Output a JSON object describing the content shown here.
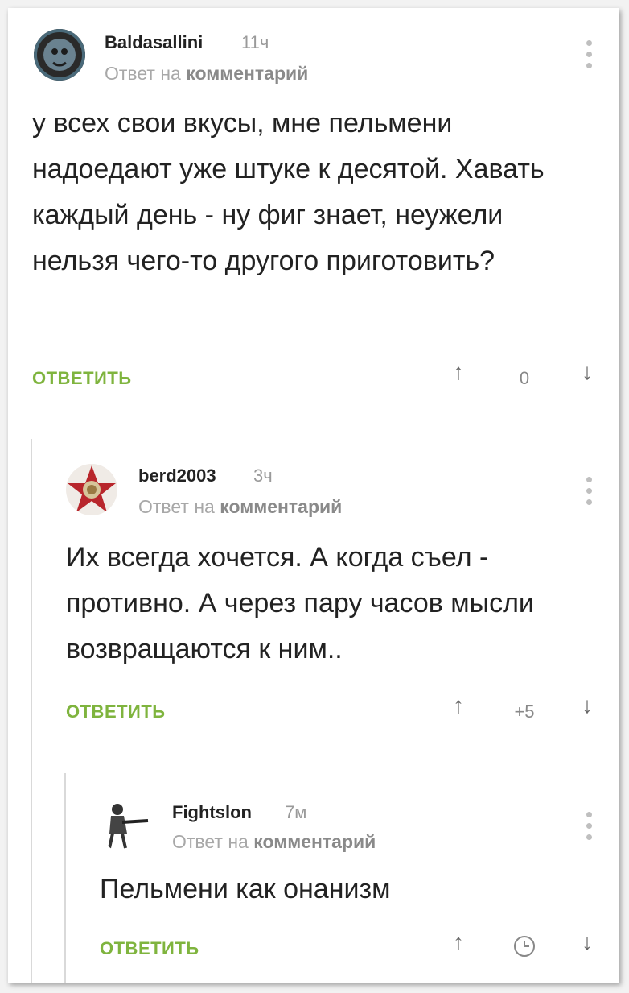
{
  "reply_prefix": "Ответ на",
  "reply_link": "комментарий",
  "reply_button": "ОТВЕТИТЬ",
  "upvote_icon": "↑",
  "downvote_icon": "↓",
  "comments": [
    {
      "username": "Baldasallini",
      "time": "11ч",
      "text": "у всех свои вкусы, мне пельмени надоедают уже штуке к десятой. Хавать каждый день - ну фиг знает, неужели нельзя чего-то другого приготовить?",
      "rating": "0"
    },
    {
      "username": "berd2003",
      "time": "3ч",
      "text": "Их всегда хочется. А когда съел - противно. А через пару часов мысли возвращаются к ним..",
      "rating": "+5"
    },
    {
      "username": "Fightslon",
      "time": "7м",
      "text": "Пельмени как онанизм",
      "rating_icon": "clock-icon"
    }
  ],
  "colors": {
    "accent": "#7fb43e",
    "text": "#222222",
    "muted": "#9a9a9a",
    "thread_line": "#d9d9d9"
  }
}
